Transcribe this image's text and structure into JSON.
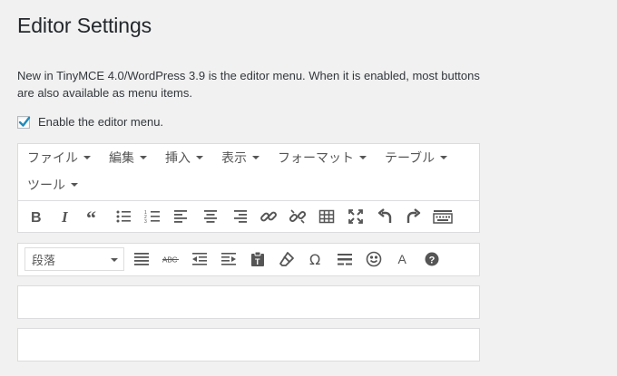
{
  "page": {
    "title": "Editor Settings",
    "description": "New in TinyMCE 4.0/WordPress 3.9 is the editor menu. When it is enabled, most buttons are also available as menu items.",
    "enable_menu_label": "Enable the editor menu.",
    "enable_menu_checked": true
  },
  "menubar": {
    "items": [
      "ファイル",
      "編集",
      "挿入",
      "表示",
      "フォーマット",
      "テーブル"
    ],
    "items_row2": [
      "ツール"
    ]
  },
  "toolbar1": {
    "icons": [
      "bold-icon",
      "italic-icon",
      "blockquote-icon",
      "bullet-list-icon",
      "numbered-list-icon",
      "align-left-icon",
      "align-center-icon",
      "align-right-icon",
      "link-icon",
      "unlink-icon",
      "table-icon",
      "fullscreen-icon",
      "undo-icon",
      "redo-icon",
      "toolbar-toggle-icon"
    ]
  },
  "toolbar2": {
    "format_select": "段落",
    "icons": [
      "justify-icon",
      "strikethrough-icon",
      "outdent-icon",
      "indent-icon",
      "paste-text-icon",
      "clear-formatting-icon",
      "special-character-icon",
      "horizontal-rule-icon",
      "emoticons-icon",
      "text-color-icon",
      "help-icon"
    ]
  },
  "colors": {
    "accent_check": "#1e8cbe",
    "text": "#23282d",
    "icon": "#555555"
  }
}
